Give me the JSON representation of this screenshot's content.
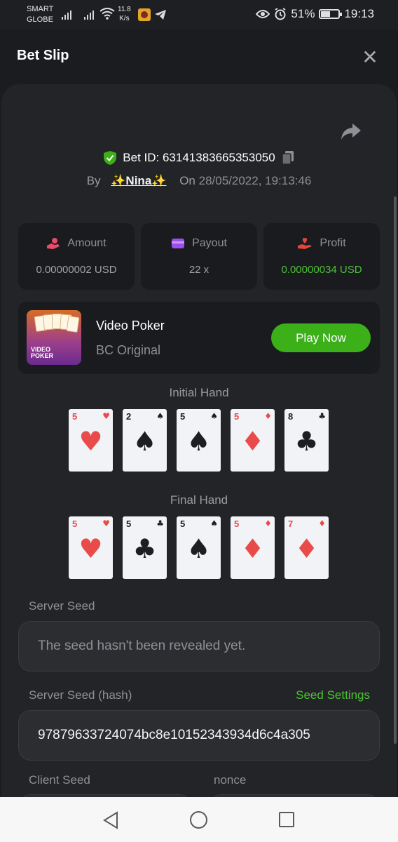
{
  "status_bar": {
    "carrier_line1": "SMART",
    "carrier_line2": "GLOBE",
    "speed_value": "11.8",
    "speed_unit": "K/s",
    "battery": "51%",
    "time": "19:13"
  },
  "header": {
    "title": "Bet Slip",
    "close_glyph": "✕"
  },
  "bet": {
    "id_label": "Bet ID: 63141383665353050",
    "by_label": "By",
    "user": "✨Nina✨",
    "on_label": "On",
    "date": "28/05/2022, 19:13:46"
  },
  "stats": [
    {
      "label": "Amount",
      "value": "0.00000002 USD",
      "icon": "hand-coins-icon",
      "color": "#e94b6a"
    },
    {
      "label": "Payout",
      "value": "22 x",
      "icon": "wallet-icon",
      "color": "#9d4df0"
    },
    {
      "label": "Profit",
      "value": "0.00000034 USD",
      "icon": "hand-heart-icon",
      "color": "#e0463c"
    }
  ],
  "game": {
    "name": "Video Poker",
    "subtitle": "BC Original",
    "thumb_text_line1": "VIDEO",
    "thumb_text_line2": "POKER",
    "play_label": "Play Now"
  },
  "initial_hand": {
    "label": "Initial Hand",
    "cards": [
      {
        "rank": "5",
        "suit": "♥",
        "color": "red"
      },
      {
        "rank": "2",
        "suit": "♠",
        "color": "black"
      },
      {
        "rank": "5",
        "suit": "♠",
        "color": "black"
      },
      {
        "rank": "5",
        "suit": "♦",
        "color": "red"
      },
      {
        "rank": "8",
        "suit": "♣",
        "color": "black"
      }
    ]
  },
  "final_hand": {
    "label": "Final Hand",
    "cards": [
      {
        "rank": "5",
        "suit": "♥",
        "color": "red"
      },
      {
        "rank": "5",
        "suit": "♣",
        "color": "black"
      },
      {
        "rank": "5",
        "suit": "♠",
        "color": "black"
      },
      {
        "rank": "5",
        "suit": "♦",
        "color": "red"
      },
      {
        "rank": "7",
        "suit": "♦",
        "color": "red"
      }
    ]
  },
  "server_seed": {
    "label": "Server Seed",
    "placeholder": "The seed hasn't been revealed yet."
  },
  "server_seed_hash": {
    "label": "Server Seed (hash)",
    "link": "Seed Settings",
    "value": "97879633724074bc8e10152343934d6c4a305"
  },
  "client_seed": {
    "label": "Client Seed"
  },
  "nonce": {
    "label": "nonce"
  },
  "colors": {
    "accent_green": "#3bb019",
    "profit_green": "#4bc236",
    "background": "#1b1c20",
    "panel": "#232427"
  }
}
